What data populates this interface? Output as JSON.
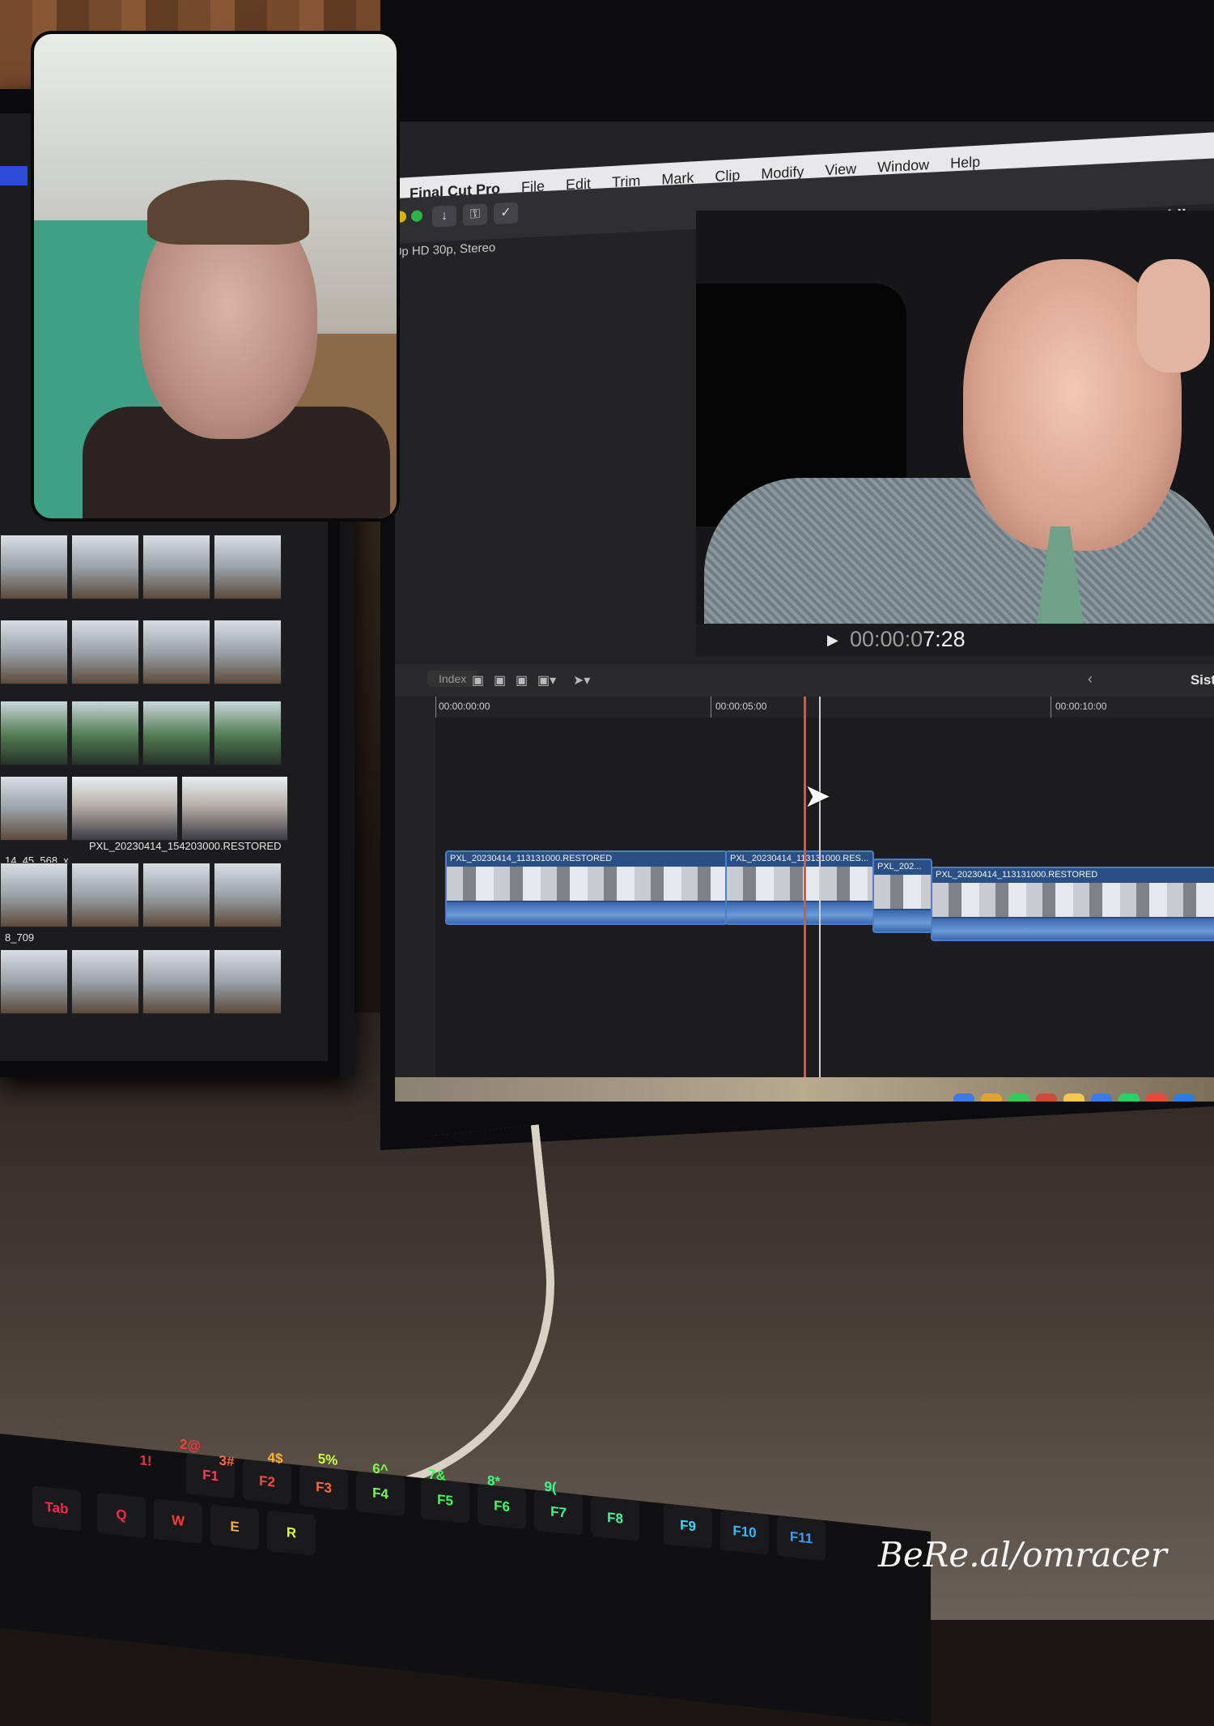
{
  "app": {
    "menu": [
      "Final Cut Pro",
      "File",
      "Edit",
      "Trim",
      "Mark",
      "Clip",
      "Modify",
      "View",
      "Window",
      "Help"
    ],
    "project_title": "Sisters wedding",
    "project_title_short": "Sist",
    "format_info": "0p HD 30p, Stereo",
    "timecode_dim": "00:00:0",
    "timecode_bright": "7:28",
    "index_label": "Index"
  },
  "timeline": {
    "ruler": [
      "00:00:00:00",
      "00:00:05:00",
      "00:00:10:00"
    ],
    "clips": [
      "PXL_20230414_113131000.RESTORED",
      "PXL_20230414_113131000.RES...",
      "PXL_202...",
      "PXL_20230414_113131000.RESTORED"
    ]
  },
  "browser": {
    "labels": [
      "PXL_20230414_154203000.RESTORED",
      "14_45_568_x",
      "8_709"
    ]
  },
  "dock_colors": [
    "#3b7be8",
    "#e0a530",
    "#35c759",
    "#d04a3a",
    "#f2c94c",
    "#3b7be8",
    "#25d366",
    "#e84a3a",
    "#2f7de1"
  ],
  "keyboard": [
    "F1",
    "F2",
    "F3",
    "F4",
    "F5",
    "F6",
    "F7",
    "F8",
    "F9",
    "F10",
    "F11",
    "Tab",
    "Q",
    "W",
    "E",
    "R",
    "1!",
    "2@",
    "3#",
    "4$",
    "5%",
    "6^",
    "7&",
    "8*",
    "9("
  ],
  "watermark": "BeRe.al/omracer"
}
